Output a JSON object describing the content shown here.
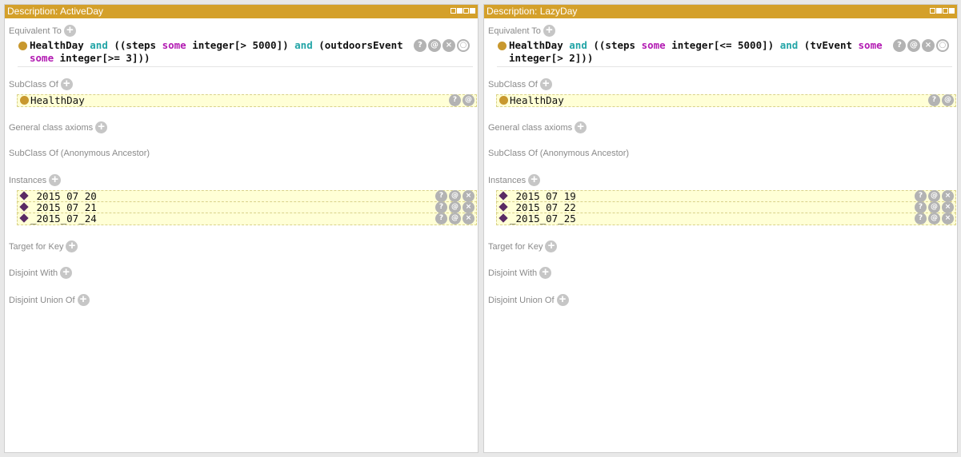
{
  "panels": [
    {
      "title": "Description: ActiveDay",
      "sections": {
        "equivalent_to": "Equivalent To",
        "subclass_of": "SubClass Of",
        "general_axioms": "General class axioms",
        "anon_ancestor": "SubClass Of (Anonymous Ancestor)",
        "instances": "Instances",
        "target_for_key": "Target for Key",
        "disjoint_with": "Disjoint With",
        "disjoint_union": "Disjoint Union Of"
      },
      "equivalent": {
        "t1": "HealthDay ",
        "k1": "and",
        "t2": " ((steps ",
        "k2": "some",
        "t3": " integer[> 5000]) ",
        "k3": "and",
        "t4": " (outdoorsEvent ",
        "k4": "some",
        "t5": " integer[>= 3]))"
      },
      "superclass": "HealthDay",
      "instances": [
        "_2015_07_20",
        "_2015_07_21",
        "_2015_07_24"
      ]
    },
    {
      "title": "Description: LazyDay",
      "sections": {
        "equivalent_to": "Equivalent To",
        "subclass_of": "SubClass Of",
        "general_axioms": "General class axioms",
        "anon_ancestor": "SubClass Of (Anonymous Ancestor)",
        "instances": "Instances",
        "target_for_key": "Target for Key",
        "disjoint_with": "Disjoint With",
        "disjoint_union": "Disjoint Union Of"
      },
      "equivalent": {
        "t1": "HealthDay ",
        "k1": "and",
        "t2": " ((steps ",
        "k2": "some",
        "t3": " integer[<= 5000]) ",
        "k3": "and",
        "t4": " (tvEvent ",
        "k4": "some",
        "t5": " integer[> 2]))"
      },
      "superclass": "HealthDay",
      "instances": [
        "_2015_07_19",
        "_2015_07_22",
        "_2015_07_25"
      ]
    }
  ],
  "icons": {
    "add": "+",
    "help": "?",
    "annotate": "@",
    "delete": "×",
    "edit": "○"
  },
  "colors": {
    "titlebar": "#d4a02a",
    "keyword_and": "#23a5a7",
    "keyword_some": "#b21ab2",
    "class_dot": "#c8982e",
    "individual": "#5a2a63",
    "highlight_row": "#ffffd6"
  }
}
